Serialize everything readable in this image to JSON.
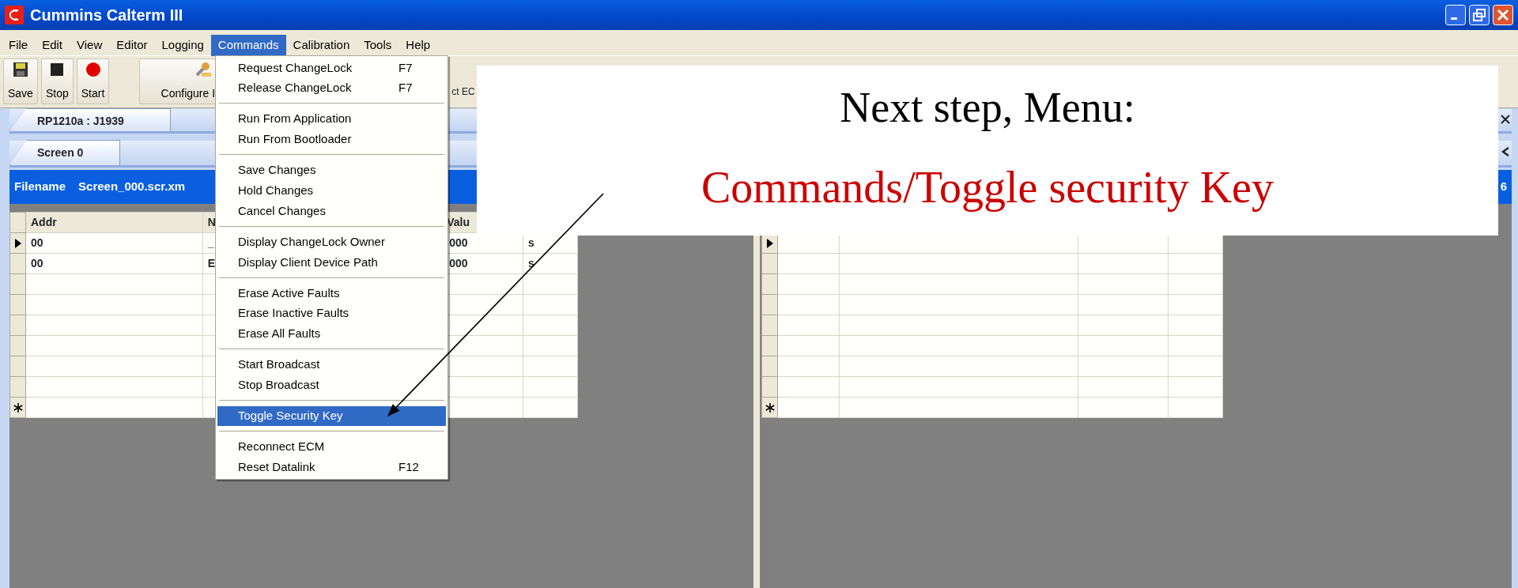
{
  "window": {
    "title": "Cummins Calterm III"
  },
  "menu_bar": [
    {
      "label": "File",
      "selected": false
    },
    {
      "label": "Edit",
      "selected": false
    },
    {
      "label": "View",
      "selected": false
    },
    {
      "label": "Editor",
      "selected": false
    },
    {
      "label": "Logging",
      "selected": false
    },
    {
      "label": "Commands",
      "selected": true
    },
    {
      "label": "Calibration",
      "selected": false
    },
    {
      "label": "Tools",
      "selected": false
    },
    {
      "label": "Help",
      "selected": false
    }
  ],
  "toolbar": [
    {
      "label": "Save",
      "kind": "save"
    },
    {
      "label": "Stop",
      "kind": "stop"
    },
    {
      "label": "Start",
      "kind": "start"
    },
    {
      "label": "Configure I",
      "kind": "configure"
    },
    {
      "label": "ct EC",
      "kind": "partial"
    }
  ],
  "left_panel": {
    "connection_tab": "RP1210a : J1939",
    "screen_tab": "Screen 0",
    "filename_label": "Filename",
    "filename": "Screen_000.scr.xm",
    "table": {
      "columns": [
        "Addr",
        "N",
        "Valu"
      ],
      "rows": [
        {
          "current": true,
          "cells": [
            "00",
            "_",
            "000",
            "s"
          ]
        },
        {
          "current": false,
          "cells": [
            "00",
            "E",
            "000",
            "s"
          ]
        }
      ]
    }
  },
  "right_panel": {
    "filename_fragment": "6",
    "table": {
      "rows": [
        {
          "current": true
        },
        {
          "current": false
        },
        {
          "current": false
        },
        {
          "current": false
        },
        {
          "current": false
        },
        {
          "current": false
        },
        {
          "current": false
        },
        {
          "current": false
        }
      ]
    }
  },
  "commands_menu": {
    "groups": [
      [
        {
          "label": "Request ChangeLock",
          "shortcut": "F7",
          "selected": false
        },
        {
          "label": "Release ChangeLock",
          "shortcut": "F7",
          "selected": false
        }
      ],
      [
        {
          "label": "Run From Application",
          "selected": false
        },
        {
          "label": "Run From Bootloader",
          "selected": false
        }
      ],
      [
        {
          "label": "Save Changes",
          "selected": false
        },
        {
          "label": "Hold Changes",
          "selected": false
        },
        {
          "label": "Cancel Changes",
          "selected": false
        }
      ],
      [
        {
          "label": "Display ChangeLock Owner",
          "selected": false
        },
        {
          "label": "Display Client Device Path",
          "selected": false
        }
      ],
      [
        {
          "label": "Erase Active Faults",
          "selected": false
        },
        {
          "label": "Erase Inactive Faults",
          "selected": false
        },
        {
          "label": "Erase All Faults",
          "selected": false
        }
      ],
      [
        {
          "label": "Start Broadcast",
          "selected": false
        },
        {
          "label": "Stop Broadcast",
          "selected": false
        }
      ],
      [
        {
          "label": "Toggle Security Key",
          "selected": true
        }
      ],
      [
        {
          "label": "Reconnect ECM",
          "selected": false
        },
        {
          "label": "Reset Datalink",
          "shortcut": "F12",
          "selected": false
        }
      ]
    ]
  },
  "callout": {
    "heading": "Next step, Menu:",
    "instruction": "Commands/Toggle security Key"
  }
}
